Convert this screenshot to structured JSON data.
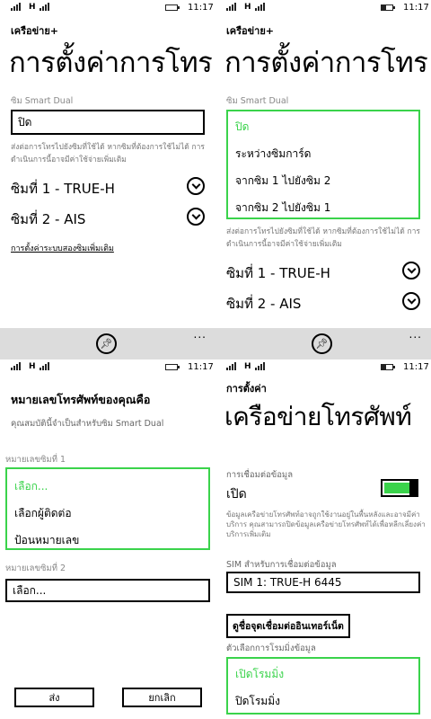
{
  "status": {
    "network_label": "H",
    "time": "11:17"
  },
  "colors": {
    "accent": "#3ad34b",
    "appbar": "#dcdcdc"
  },
  "panel1": {
    "app_title": "เครือข่าย+",
    "page_title": "การตั้งค่าการโทร",
    "smart_dual_label": "ซิม Smart Dual",
    "smart_dual_value": "ปิด",
    "description": "ส่งต่อการโทรไปยังซิมที่ใช้ได้ หากซิมที่ต้องการใช้ไม่ได้ การดำเนินการนี้อาจมีค่าใช้จ่ายเพิ่มเติม",
    "sim1": "ซิมที่ 1 - TRUE-H",
    "sim2": "ซิมที่ 2 - AIS",
    "link": "การตั้งค่าระบบสองซิมเพิ่มเติม"
  },
  "panel2": {
    "app_title": "เครือข่าย+",
    "page_title": "การตั้งค่าการโทร",
    "smart_dual_label": "ซิม Smart Dual",
    "options": [
      "ปิด",
      "ระหว่างซิมการ์ด",
      "จากซิม 1 ไปยังซิม 2",
      "จากซิม 2 ไปยังซิม 1"
    ],
    "description": "ส่งต่อการโทรไปยังซิมที่ใช้ได้ หากซิมที่ต้องการใช้ไม่ได้ การดำเนินการนี้อาจมีค่าใช้จ่ายเพิ่มเติม",
    "sim1": "ซิมที่ 1 - TRUE-H",
    "sim2": "ซิมที่ 2 - AIS"
  },
  "appbar": {
    "pin_icon": "pin-icon",
    "more": "..."
  },
  "panel3": {
    "heading": "หมายเลขโทรศัพท์ของคุณคือ",
    "subheading": "คุณสมบัตินี้จำเป็นสำหรับซิม Smart Dual",
    "sim1_label": "หมายเลขซิมที่ 1",
    "sim1_options": [
      "เลือก...",
      "เลือกผู้ติดต่อ",
      "ป้อนหมายเลข"
    ],
    "sim2_label": "หมายเลขซิมที่ 2",
    "sim2_value": "เลือก...",
    "send": "ส่ง",
    "cancel": "ยกเลิก"
  },
  "panel4": {
    "section": "การตั้งค่า",
    "page_title": "เครือข่ายโทรศัพท์",
    "data_label": "การเชื่อมต่อข้อมูล",
    "data_value": "เปิด",
    "data_desc": "ข้อมูลเครือข่ายโทรศัพท์อาจถูกใช้งานอยู่ในพื้นหลังและอาจมีค่าบริการ คุณสามารถปิดข้อมูลเครือข่ายโทรศัพท์ได้เพื่อหลีกเลี่ยงค่าบริการเพิ่มเติม",
    "sim_label": "SIM สำหรับการเชื่อมต่อข้อมูล",
    "sim_value": "SIM 1: TRUE-H 6445",
    "apn_button": "ดูชื่อจุดเชื่อมต่ออินเทอร์เน็ต",
    "roaming_label": "ตัวเลือกการโรมมิ่งข้อมูล",
    "roaming_options": [
      "เปิดโรมมิ่ง",
      "ปิดโรมมิ่ง"
    ]
  }
}
